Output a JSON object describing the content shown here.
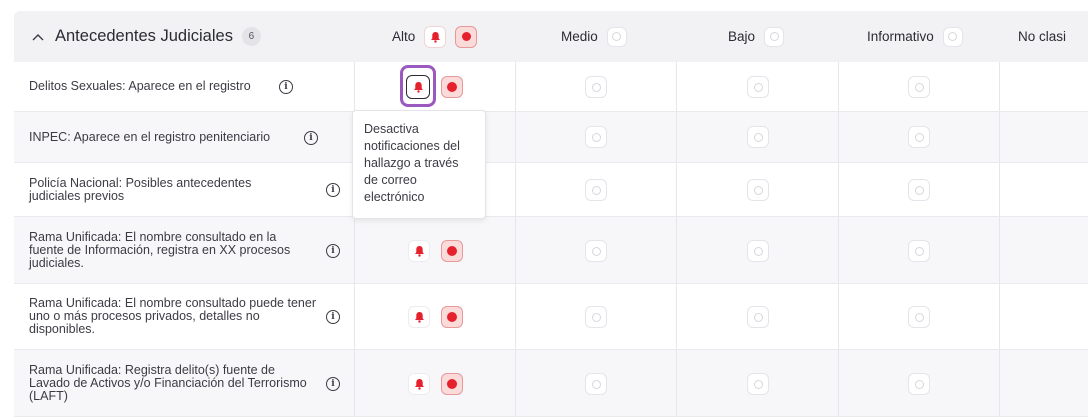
{
  "section": {
    "title": "Antecedentes Judiciales",
    "count": "6"
  },
  "columns": [
    {
      "label": "Alto"
    },
    {
      "label": "Medio"
    },
    {
      "label": "Bajo"
    },
    {
      "label": "Informativo"
    },
    {
      "label": "No clasi"
    }
  ],
  "rows": [
    {
      "label": "Delitos Sexuales: Aparece en el registro"
    },
    {
      "label": "INPEC: Aparece en el registro penitenciario"
    },
    {
      "label": "Policía Nacional: Posibles antecedentes judiciales previos"
    },
    {
      "label": "Rama Unificada: El nombre consultado en la fuente de Información, registra en XX procesos judiciales."
    },
    {
      "label": "Rama Unificada: El nombre consultado puede tener uno o más procesos privados, detalles no disponibles."
    },
    {
      "label": "Rama Unificada: Registra delito(s) fuente de Lavado de Activos y/o Financiación del Terrorismo (LAFT)"
    }
  ],
  "tooltip": {
    "text": "Desactiva notificaciones del hallazgo a través de correo electrónico"
  },
  "colors": {
    "accent_red": "#e5212e",
    "focus_purple": "#9b59c0",
    "header_bg": "#f2f2f4"
  },
  "icons": {
    "chevron": "chevron-up-icon",
    "bell": "bell-icon",
    "info": "info-icon"
  }
}
